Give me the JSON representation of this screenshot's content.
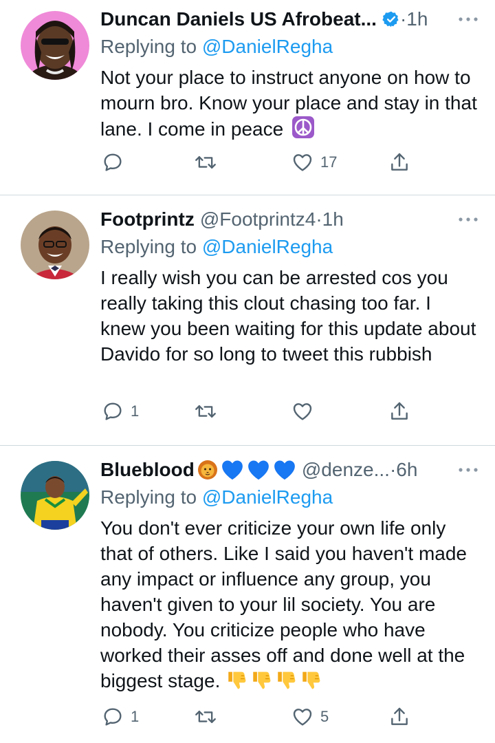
{
  "tweets": [
    {
      "name": "Duncan Daniels US Afrobeat...",
      "handle": "",
      "time": "1h",
      "verified": true,
      "replying_label": "Replying to",
      "replying_to": "@DanielRegha",
      "text": "Not your place to instruct anyone on how to mourn bro. Know your place and stay in that lane. I come in peace",
      "trailing_emoji": "peace-symbol",
      "reply_count": "",
      "retweet_count": "",
      "like_count": "17"
    },
    {
      "name": "Footprintz",
      "handle": "@Footprintz4",
      "time": "1h",
      "verified": false,
      "replying_label": "Replying to",
      "replying_to": "@DanielRegha",
      "text": "I really wish you can be arrested cos you really taking this clout chasing too far. I knew you been waiting for this update about Davido for so long to tweet this rubbish",
      "reply_count": "1",
      "retweet_count": "",
      "like_count": ""
    },
    {
      "name": "Blueblood",
      "name_emojis": [
        "lion-face",
        "blue-heart",
        "blue-heart",
        "blue-heart"
      ],
      "handle": "@denze...",
      "time": "6h",
      "verified": false,
      "replying_label": "Replying to",
      "replying_to": "@DanielRegha",
      "text": "You don't ever criticize your own life only that of others. Like I said you haven't made any impact or influence any group, you haven't given to your lil society. You are nobody. You criticize people who have worked their asses off and done well at the biggest stage.",
      "trailing_emojis": [
        "thumbs-down",
        "thumbs-down",
        "thumbs-down",
        "thumbs-down"
      ],
      "reply_count": "1",
      "retweet_count": "",
      "like_count": "5"
    }
  ],
  "separator": " · ",
  "colors": {
    "text": "#0f1419",
    "muted": "#536471",
    "link": "#1d9bf0",
    "divider": "#cfd9de"
  }
}
